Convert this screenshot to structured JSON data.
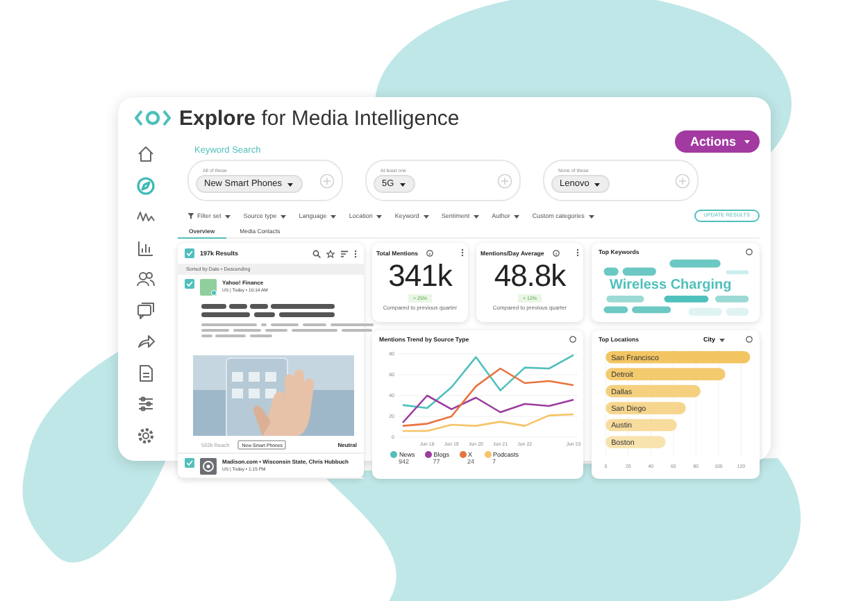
{
  "app": {
    "title": "**Explore** for Media Intelligence"
  },
  "sidebar": {
    "items": [
      {
        "kind": "home",
        "selected": false
      },
      {
        "kind": "compass",
        "selected": true
      },
      {
        "kind": "wave",
        "selected": false
      },
      {
        "kind": "chart",
        "selected": false
      },
      {
        "kind": "people",
        "selected": false
      },
      {
        "kind": "chat",
        "selected": false
      },
      {
        "kind": "share",
        "selected": false
      },
      {
        "kind": "document",
        "selected": false
      },
      {
        "kind": "sliders",
        "selected": false
      },
      {
        "kind": "gear",
        "selected": false
      }
    ]
  },
  "actions_button": "Actions",
  "keyword_search": {
    "title": "Keyword Search",
    "groups": [
      {
        "label": "All of these",
        "chip": "New Smart Phones"
      },
      {
        "label": "At least one",
        "chip": "5G"
      },
      {
        "label": "None of these",
        "chip": "Lenovo"
      }
    ]
  },
  "filters": [
    {
      "label": "Filter set",
      "kind": "set"
    },
    {
      "label": "Source type",
      "kind": "dropdown"
    },
    {
      "label": "Language",
      "kind": "dropdown"
    },
    {
      "label": "Location",
      "kind": "dropdown"
    },
    {
      "label": "Keyword",
      "kind": "dropdown"
    },
    {
      "label": "Sentiment",
      "kind": "dropdown"
    },
    {
      "label": "Author",
      "kind": "dropdown"
    },
    {
      "label": "Custom categories",
      "kind": "dropdown"
    }
  ],
  "update_button": "UPDATE RESULTS",
  "tabs": [
    {
      "label": "Overview",
      "selected": true
    },
    {
      "label": "Media Contacts",
      "selected": false
    }
  ],
  "results": {
    "title": "197k Results",
    "checked": true,
    "sort": "Sorted by Date • Descending",
    "items": [
      {
        "source": "Yahoo! Finance",
        "meta": "US | Today • 10:14 AM",
        "checked": true,
        "reach": "502k Reach",
        "tag": "New Smart Phones",
        "sentiment": "Neutral"
      },
      {
        "source": "Madison.com • Wisconsin State, Chris Hubbuch",
        "meta": "US | Today • 1:15 PM",
        "checked": true
      }
    ]
  },
  "metrics": [
    {
      "title": "Total Mentions",
      "value": "341k",
      "change": "+ 25%",
      "note": "Compared to previous quarter"
    },
    {
      "title": "Mentions/Day Average",
      "value": "48.8k",
      "change": "+ 12%",
      "note": "Compared to previous quarter"
    }
  ],
  "top_keywords": {
    "title": "Top Keywords",
    "keyword": "Wireless Charging"
  },
  "trend": {
    "title": "Mentions Trend by Source Type",
    "chart_data": {
      "type": "line",
      "categories": [
        null,
        "Jun 18",
        "Jun 19",
        "Jun 20",
        "Jun 21",
        "Jun 22",
        null,
        "Jun 23"
      ],
      "ylim": [
        0,
        80
      ],
      "yticks": [
        0,
        20,
        40,
        60,
        80
      ],
      "grid": true,
      "series": [
        {
          "name": "News",
          "color": "#4fc0bb",
          "values": [
            31,
            28,
            48,
            77,
            45,
            67,
            66,
            79
          ]
        },
        {
          "name": "Blogs",
          "color": "#9b3c9e",
          "values": [
            14,
            40,
            27,
            38,
            24,
            32,
            30,
            36
          ]
        },
        {
          "name": "X",
          "color": "#e8733d",
          "values": [
            11,
            13,
            20,
            49,
            66,
            52,
            54,
            50
          ]
        },
        {
          "name": "Podcasts",
          "color": "#f5c466",
          "values": [
            6,
            6,
            12,
            11,
            15,
            11,
            21,
            22
          ]
        }
      ]
    },
    "legend_counts": [
      "942",
      "77",
      "24",
      "7"
    ]
  },
  "locations": {
    "title": "Top Locations",
    "dropdown": "City",
    "chart_data": {
      "type": "bar",
      "orientation": "horizontal",
      "categories": [
        "San Francisco",
        "Detroit",
        "Dallas",
        "San Diego",
        "Austin",
        "Boston"
      ],
      "values": [
        128,
        106,
        84,
        71,
        63,
        53
      ],
      "xlim": [
        0,
        130
      ],
      "xticks": [
        0,
        20,
        40,
        60,
        80,
        100,
        120
      ],
      "grid": true
    }
  }
}
